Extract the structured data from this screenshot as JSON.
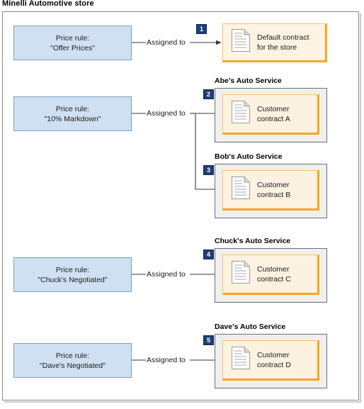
{
  "diagram": {
    "title": "Minelli Automotive store",
    "type": "relationship-diagram",
    "connector_label": "Assigned to",
    "colors": {
      "rule_fill": "#cfe0f2",
      "rule_border": "#7a9fc4",
      "contract_fill": "#fdf1e0",
      "contract_border": "#f5a623",
      "org_fill": "#efefef",
      "org_border": "#6e6e6e",
      "badge_fill": "#1f3f78",
      "frame_border": "#8a8a8a"
    }
  },
  "rules": [
    {
      "line1": "Price rule:",
      "line2": "\"Offer Prices\""
    },
    {
      "line1": "Price rule:",
      "line2": "\"10% Markdown\""
    },
    {
      "line1": "Price rule:",
      "line2": "\"Chuck's Negotiated\""
    },
    {
      "line1": "Price rule:",
      "line2": "\"Dave's Negotiated\""
    }
  ],
  "connector_labels": [
    "Assigned to",
    "Assigned to",
    "Assigned to",
    "Assigned to"
  ],
  "steps": [
    {
      "number": "1"
    },
    {
      "number": "2"
    },
    {
      "number": "3"
    },
    {
      "number": "4"
    },
    {
      "number": "5"
    }
  ],
  "organizations": [
    {
      "name": "Abe's Auto Service"
    },
    {
      "name": "Bob's Auto Service"
    },
    {
      "name": "Chuck's Auto Service"
    },
    {
      "name": "Dave's Auto Service"
    }
  ],
  "contracts": [
    {
      "line1": "Default contract",
      "line2": "for the store",
      "icon": "document-icon"
    },
    {
      "line1": "Customer",
      "line2": "contract A",
      "icon": "document-icon"
    },
    {
      "line1": "Customer",
      "line2": "contract B",
      "icon": "document-icon"
    },
    {
      "line1": "Customer",
      "line2": "contract C",
      "icon": "document-icon"
    },
    {
      "line1": "Customer",
      "line2": "contract D",
      "icon": "document-icon"
    }
  ]
}
